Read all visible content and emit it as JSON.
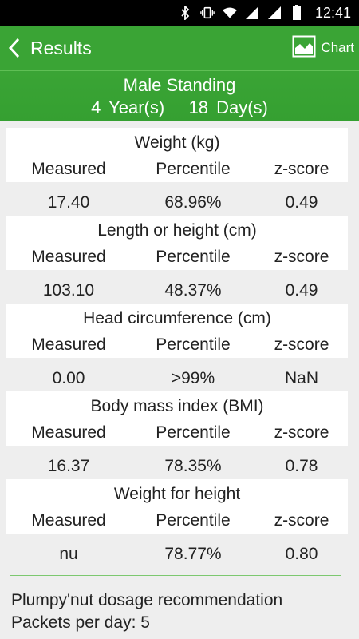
{
  "status_bar": {
    "time": "12:41",
    "icons": [
      "bluetooth-icon",
      "vibrate-icon",
      "wifi-icon",
      "signal-icon",
      "signal-icon",
      "battery-icon"
    ]
  },
  "action_bar": {
    "title": "Results",
    "chart_label": "Chart"
  },
  "header": {
    "line1": "Male Standing",
    "line2": "4 Year(s)   18 Day(s)"
  },
  "measurements": [
    {
      "title": "Weight (kg)",
      "col1": "Measured",
      "col2": "Percentile",
      "col3": "z-score",
      "measured": "17.40",
      "percentile": "68.96%",
      "zscore": "0.49"
    },
    {
      "title": "Length or height (cm)",
      "col1": "Measured",
      "col2": "Percentile",
      "col3": "z-score",
      "measured": "103.10",
      "percentile": "48.37%",
      "zscore": "0.49"
    },
    {
      "title": "Head circumference (cm)",
      "col1": "Measured",
      "col2": "Percentile",
      "col3": "z-score",
      "measured": "0.00",
      "percentile": ">99%",
      "zscore": "NaN"
    },
    {
      "title": "Body mass index (BMI)",
      "col1": "Measured",
      "col2": "Percentile",
      "col3": "z-score",
      "measured": "16.37",
      "percentile": "78.35%",
      "zscore": "0.78"
    },
    {
      "title": "Weight for height",
      "col1": "Measured",
      "col2": "Percentile",
      "col3": "z-score",
      "measured": "nu",
      "percentile": "78.77%",
      "zscore": "0.80"
    }
  ],
  "footer": {
    "line1": "Plumpy'nut dosage recommendation",
    "line2": "Packets per day: 5"
  },
  "colors": {
    "accent": "#3aa435",
    "divider": "#7cc86f"
  }
}
